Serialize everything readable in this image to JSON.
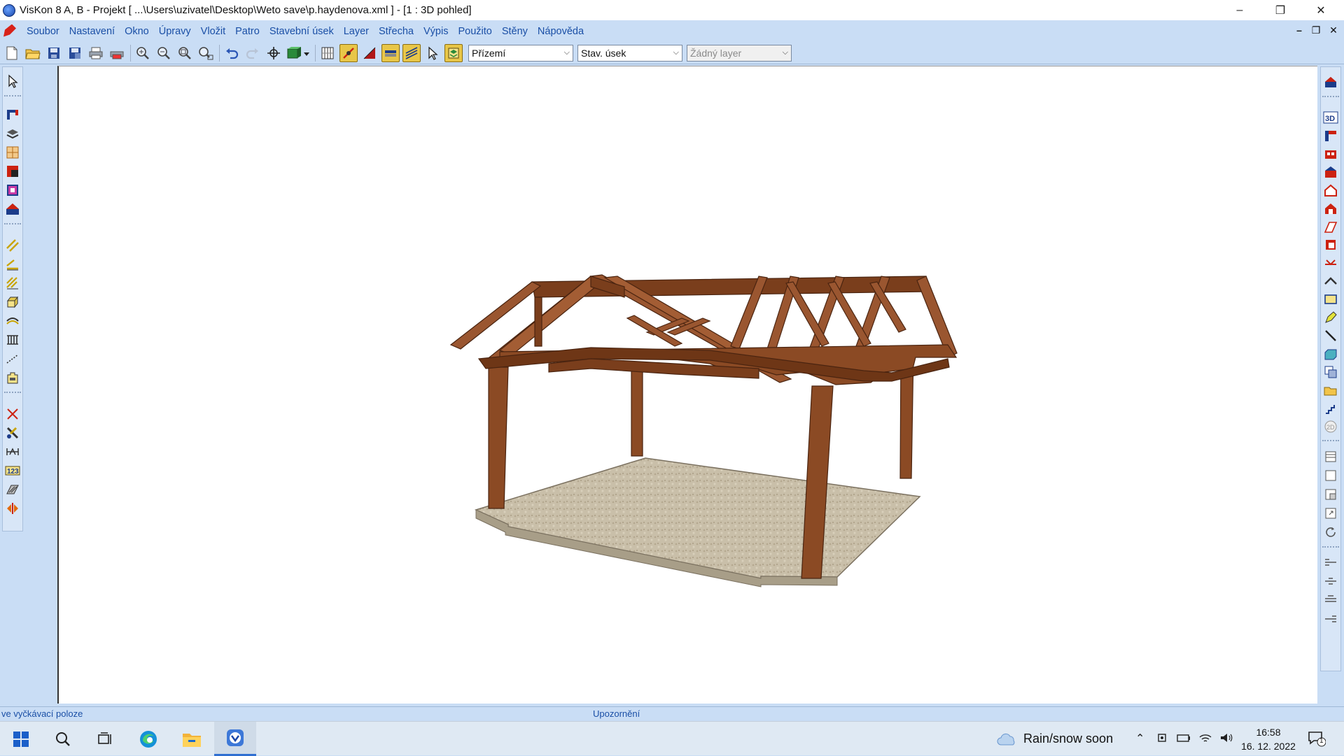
{
  "window": {
    "title": "VisKon 8 A, B - Projekt [ ...\\Users\\uzivatel\\Desktop\\Weto save\\p.haydenova.xml ]  - [1 : 3D pohled]",
    "controls": [
      "–",
      "❐",
      "✕"
    ]
  },
  "menubar": {
    "items": [
      "Soubor",
      "Nastavení",
      "Okno",
      "Úpravy",
      "Vložit",
      "Patro",
      "Stavební úsek",
      "Layer",
      "Střecha",
      "Výpis",
      "Použito",
      "Stěny",
      "Nápověda"
    ],
    "mdi_controls": [
      "–",
      "❐",
      "✕"
    ]
  },
  "toolbar": {
    "floor_select": "Přízemí",
    "section_select": "Stav. úsek",
    "layer_select": "Žádný layer"
  },
  "statusbar": {
    "left": "ve vyčkávací poloze",
    "center": "Upozornění"
  },
  "taskbar": {
    "weather": "Rain/snow soon",
    "time": "16:58",
    "date": "16. 12. 2022",
    "notification_count": "1"
  },
  "colors": {
    "ui_background": "#c9ddf5",
    "menu_text": "#1a4fa6",
    "timber": "#8b4a24",
    "floor": "#c9bfa9"
  }
}
